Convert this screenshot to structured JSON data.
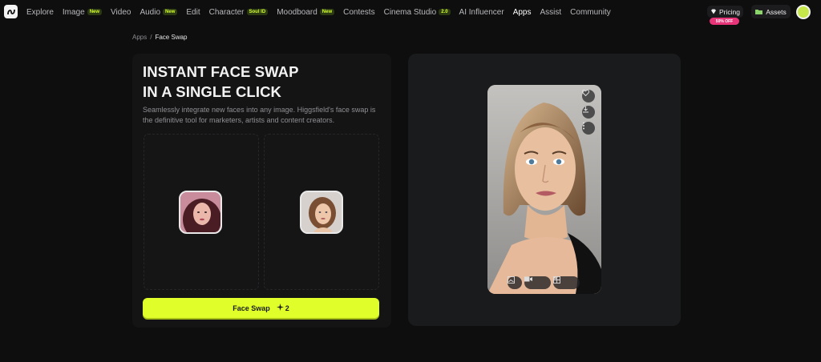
{
  "nav": {
    "items": [
      {
        "label": "Explore"
      },
      {
        "label": "Image",
        "badge": "New"
      },
      {
        "label": "Video"
      },
      {
        "label": "Audio",
        "badge": "New"
      },
      {
        "label": "Edit"
      },
      {
        "label": "Character",
        "badge": "Soul ID"
      },
      {
        "label": "Moodboard",
        "badge": "New"
      },
      {
        "label": "Contests"
      },
      {
        "label": "Cinema Studio",
        "badge": "2.0"
      },
      {
        "label": "AI Influencer"
      },
      {
        "label": "Apps"
      },
      {
        "label": "Assist"
      },
      {
        "label": "Community"
      }
    ],
    "pricing_label": "Pricing",
    "pricing_badge": "50% OFF",
    "assets_label": "Assets"
  },
  "breadcrumb": {
    "parent": "Apps",
    "separator": "/",
    "current": "Face Swap"
  },
  "main": {
    "headline_line1": "INSTANT FACE SWAP",
    "headline_line2": "IN A SINGLE CLICK",
    "description": "Seamlessly integrate new faces into any image. Higgsfield's face swap is the definitive tool for marketers, artists and content creators.",
    "button_label": "Face Swap",
    "button_credits": "2"
  },
  "colors": {
    "accent": "#e0ff2a",
    "background": "#0e0e0f",
    "badge_pink": "#e8357a"
  }
}
